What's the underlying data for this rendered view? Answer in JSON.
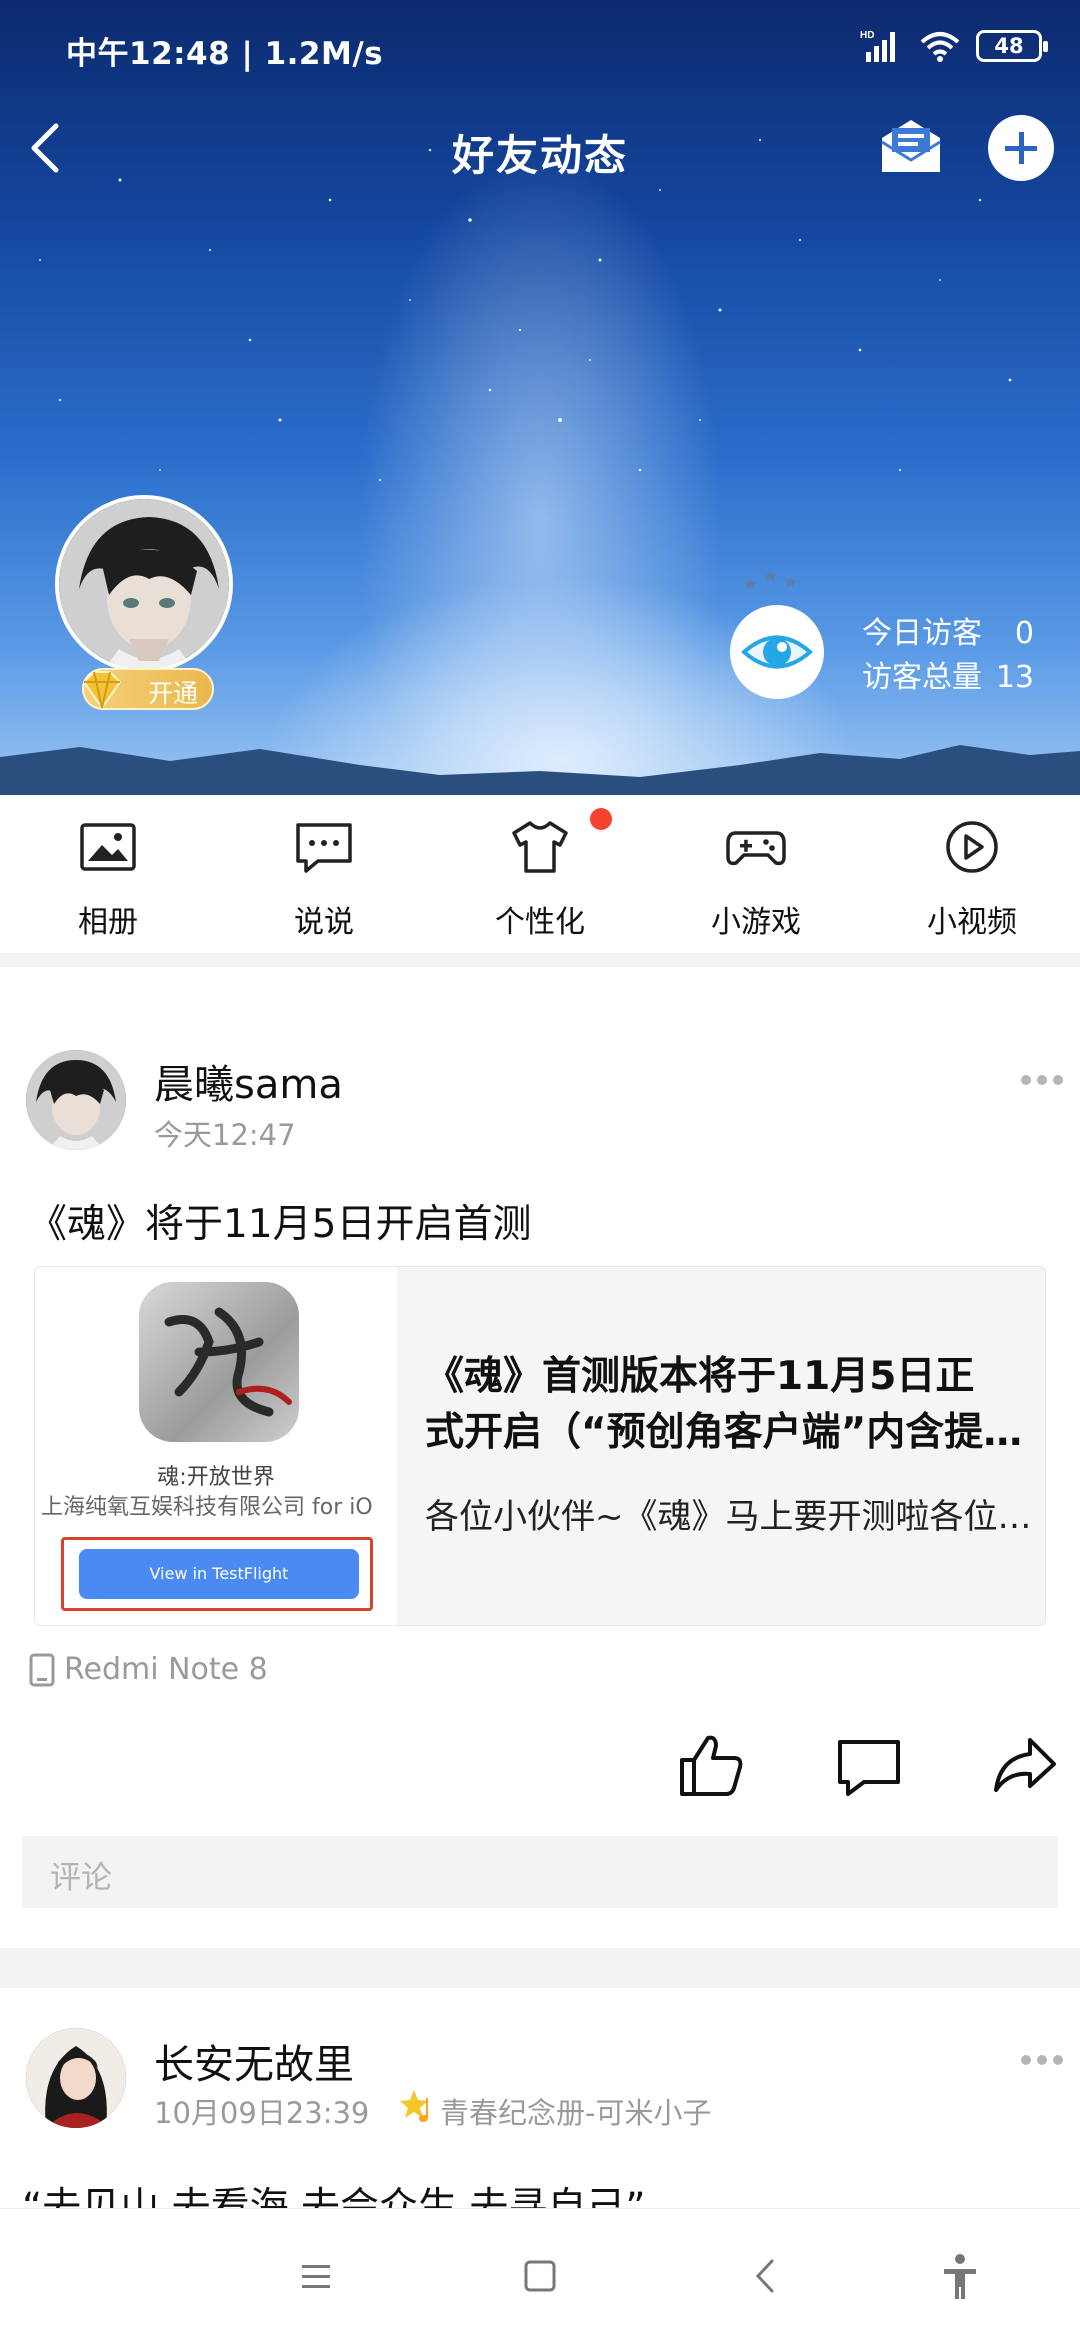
{
  "status_bar": {
    "time_speed": "中午12:48 | 1.2M/s",
    "network": "HD",
    "battery": "48"
  },
  "header": {
    "title": "好友动态"
  },
  "profile": {
    "vip_label": "开通",
    "visitors_today_label": "今日访客",
    "visitors_today": "0",
    "visitors_total_label": "访客总量",
    "visitors_total": "13"
  },
  "shortcuts": [
    {
      "label": "相册",
      "icon": "photo-album-icon"
    },
    {
      "label": "说说",
      "icon": "chat-bubble-icon"
    },
    {
      "label": "个性化",
      "icon": "tshirt-icon"
    },
    {
      "label": "小游戏",
      "icon": "gamepad-icon"
    },
    {
      "label": "小视频",
      "icon": "play-circle-icon"
    }
  ],
  "post1": {
    "author": "晨曦sama",
    "time": "今天12:47",
    "text": "《魂》将于11月5日开启首测",
    "card": {
      "thumb_app": "魂:开放世界",
      "thumb_dev": "上海纯氧互娱科技有限公司 for iO",
      "thumb_button": "View in TestFlight",
      "title_line1": "《魂》首测版本将于11月5日正",
      "title_line2": "式开启（“预创角客户端”内含提示）",
      "desc": "各位小伙伴~《魂》马上要开测啦各位小伙伴"
    },
    "device": "Redmi Note 8",
    "comment_placeholder": "评论"
  },
  "post2": {
    "author": "长安无故里",
    "time": "10月09日23:39",
    "badge": "青春纪念册-可米小子",
    "text": "“去见山 去看海 去会众生 去寻自己”"
  },
  "colors": {
    "accent_blue": "#4a8af2",
    "notify_red": "#f5432f",
    "vip_gold": "#e9b74e"
  }
}
